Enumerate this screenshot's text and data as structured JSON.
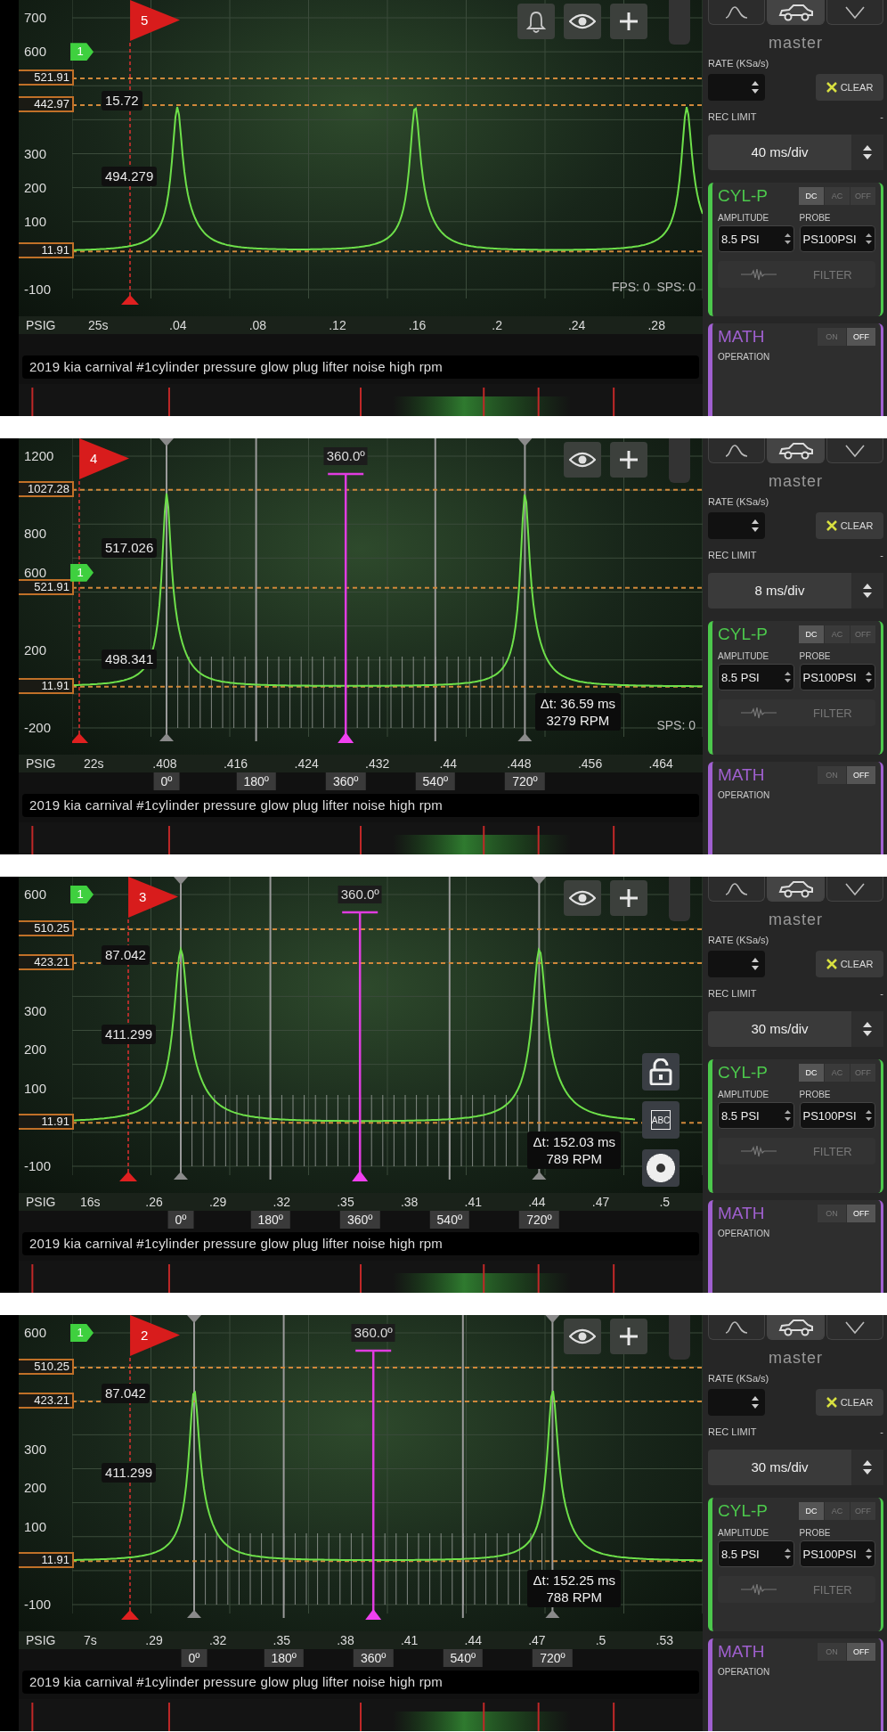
{
  "screens": [
    {
      "trigger_flag": "5",
      "ground_marker": "1",
      "y_ticks": [
        "700",
        "600",
        "300",
        "200",
        "100",
        "-100"
      ],
      "cursors": [
        {
          "label": "521.91"
        },
        {
          "label": "442.97"
        },
        {
          "label": "11.91"
        }
      ],
      "readouts": [
        "15.72",
        "494.279"
      ],
      "tools": [
        {
          "kind": "bell"
        },
        {
          "kind": "eye"
        },
        {
          "kind": "plus"
        }
      ],
      "status": "FPS: 0  SPS: 0",
      "x_unit": "PSIG",
      "x_ticks": [
        "25s",
        ".04",
        ".08",
        ".12",
        ".16",
        ".2",
        ".24",
        ".28"
      ],
      "recording_title": "2019 kia carnival #1cylinder pressure glow plug lifter noise high rpm",
      "sidebar": {
        "tabs": [
          {
            "kind": "wave",
            "selected": false
          },
          {
            "kind": "car",
            "selected": true
          },
          {
            "kind": "chevron",
            "selected": false
          }
        ],
        "mode": "master",
        "rate_label": "RATE (KSa/s)",
        "clear": "CLEAR",
        "rec_limit": "REC LIMIT",
        "rec_limit_value": "-",
        "timebase": "40 ms/div",
        "channel": {
          "name": "CYL-P",
          "couplings": [
            {
              "label": "DC",
              "selected": true
            },
            {
              "label": "AC",
              "selected": false
            },
            {
              "label": "OFF",
              "selected": false
            }
          ],
          "amplitude_label": "AMPLITUDE",
          "amplitude": "8.5 PSI",
          "probe_label": "PROBE",
          "probe": "PS100PSI",
          "filter": {
            "label": "FILTER",
            "disabled": true
          }
        },
        "math": {
          "name": "MATH",
          "toggles": [
            {
              "label": "ON",
              "selected": false
            },
            {
              "label": "OFF",
              "selected": true
            }
          ],
          "operation_label": "OPERATION"
        }
      }
    },
    {
      "trigger_flag": "4",
      "ground_marker": "1",
      "y_ticks": [
        "1200",
        "800",
        "600",
        "200",
        "-200"
      ],
      "cursors": [
        {
          "label": "1027.28"
        },
        {
          "label": "521.91"
        },
        {
          "label": "11.91"
        }
      ],
      "readouts": [
        "517.026",
        "498.341"
      ],
      "tools": [
        {
          "kind": "eye"
        },
        {
          "kind": "plus"
        }
      ],
      "angle_cursor": "360.0º",
      "angle_labels": [
        "0º",
        "180º",
        "360º",
        "540º",
        "720º"
      ],
      "delta": {
        "time": "Δt: 36.59 ms",
        "rpm": "3279 RPM"
      },
      "status": "SPS: 0",
      "x_unit": "PSIG",
      "x_ticks": [
        "22s",
        ".408",
        ".416",
        ".424",
        ".432",
        ".44",
        ".448",
        ".456",
        ".464"
      ],
      "recording_title": "2019 kia carnival #1cylinder pressure glow plug lifter noise high rpm",
      "sidebar": {
        "tabs": [
          {
            "kind": "wave",
            "selected": false
          },
          {
            "kind": "car",
            "selected": true
          },
          {
            "kind": "chevron",
            "selected": false
          }
        ],
        "mode": "master",
        "rate_label": "RATE (KSa/s)",
        "clear": "CLEAR",
        "rec_limit": "REC LIMIT",
        "rec_limit_value": "-",
        "timebase": "8 ms/div",
        "channel": {
          "name": "CYL-P",
          "couplings": [
            {
              "label": "DC",
              "selected": true
            },
            {
              "label": "AC",
              "selected": false
            },
            {
              "label": "OFF",
              "selected": false
            }
          ],
          "amplitude_label": "AMPLITUDE",
          "amplitude": "8.5 PSI",
          "probe_label": "PROBE",
          "probe": "PS100PSI",
          "filter": {
            "label": "FILTER",
            "disabled": true
          }
        },
        "math": {
          "name": "MATH",
          "toggles": [
            {
              "label": "ON",
              "selected": false
            },
            {
              "label": "OFF",
              "selected": true
            }
          ],
          "operation_label": "OPERATION"
        }
      }
    },
    {
      "trigger_flag": "3",
      "ground_marker": "1",
      "y_ticks": [
        "600",
        "300",
        "200",
        "100",
        "-100"
      ],
      "cursors": [
        {
          "label": "510.25"
        },
        {
          "label": "423.21"
        },
        {
          "label": "11.91"
        }
      ],
      "readouts": [
        "87.042",
        "411.299"
      ],
      "tools": [
        {
          "kind": "eye"
        },
        {
          "kind": "plus"
        }
      ],
      "side_tools": [
        {
          "kind": "lock"
        },
        {
          "kind": "text",
          "label": "ABC"
        },
        {
          "kind": "gear"
        }
      ],
      "angle_cursor": "360.0º",
      "angle_labels": [
        "0º",
        "180º",
        "360º",
        "540º",
        "720º"
      ],
      "delta": {
        "time": "Δt: 152.03 ms",
        "rpm": "789 RPM"
      },
      "x_unit": "PSIG",
      "x_ticks": [
        "16s",
        ".26",
        ".29",
        ".32",
        ".35",
        ".38",
        ".41",
        ".44",
        ".47",
        ".5"
      ],
      "recording_title": "2019 kia carnival #1cylinder pressure glow plug lifter noise high rpm",
      "sidebar": {
        "tabs": [
          {
            "kind": "wave",
            "selected": false
          },
          {
            "kind": "car",
            "selected": true
          },
          {
            "kind": "chevron",
            "selected": false
          }
        ],
        "mode": "master",
        "rate_label": "RATE (KSa/s)",
        "clear": "CLEAR",
        "rec_limit": "REC LIMIT",
        "rec_limit_value": "-",
        "timebase": "30 ms/div",
        "channel": {
          "name": "CYL-P",
          "couplings": [
            {
              "label": "DC",
              "selected": true
            },
            {
              "label": "AC",
              "selected": false
            },
            {
              "label": "OFF",
              "selected": false
            }
          ],
          "amplitude_label": "AMPLITUDE",
          "amplitude": "8.5 PSI",
          "probe_label": "PROBE",
          "probe": "PS100PSI",
          "filter": {
            "label": "FILTER",
            "disabled": true
          }
        },
        "math": {
          "name": "MATH",
          "toggles": [
            {
              "label": "ON",
              "selected": false
            },
            {
              "label": "OFF",
              "selected": true
            }
          ],
          "operation_label": "OPERATION"
        }
      }
    },
    {
      "trigger_flag": "2",
      "ground_marker": "1",
      "y_ticks": [
        "600",
        "300",
        "200",
        "100",
        "-100"
      ],
      "cursors": [
        {
          "label": "510.25"
        },
        {
          "label": "423.21"
        },
        {
          "label": "11.91"
        }
      ],
      "readouts": [
        "87.042",
        "411.299"
      ],
      "tools": [
        {
          "kind": "eye"
        },
        {
          "kind": "plus"
        }
      ],
      "angle_cursor": "360.0º",
      "angle_labels": [
        "0º",
        "180º",
        "360º",
        "540º",
        "720º"
      ],
      "delta": {
        "time": "Δt: 152.25 ms",
        "rpm": "788 RPM"
      },
      "x_unit": "PSIG",
      "x_ticks": [
        "7s",
        ".29",
        ".32",
        ".35",
        ".38",
        ".41",
        ".44",
        ".47",
        ".5",
        ".53"
      ],
      "recording_title": "2019 kia carnival #1cylinder pressure glow plug lifter noise high rpm",
      "sidebar": {
        "tabs": [
          {
            "kind": "wave",
            "selected": false
          },
          {
            "kind": "car",
            "selected": true
          },
          {
            "kind": "chevron",
            "selected": false
          }
        ],
        "mode": "master",
        "rate_label": "RATE (KSa/s)",
        "clear": "CLEAR",
        "rec_limit": "REC LIMIT",
        "rec_limit_value": "-",
        "timebase": "30 ms/div",
        "channel": {
          "name": "CYL-P",
          "couplings": [
            {
              "label": "DC",
              "selected": true
            },
            {
              "label": "AC",
              "selected": false
            },
            {
              "label": "OFF",
              "selected": false
            }
          ],
          "amplitude_label": "AMPLITUDE",
          "amplitude": "8.5 PSI",
          "probe_label": "PROBE",
          "probe": "PS100PSI",
          "filter": {
            "label": "FILTER",
            "disabled": true
          }
        },
        "math": {
          "name": "MATH",
          "toggles": [
            {
              "label": "ON",
              "selected": false
            },
            {
              "label": "OFF",
              "selected": true
            }
          ],
          "operation_label": "OPERATION"
        }
      }
    }
  ]
}
